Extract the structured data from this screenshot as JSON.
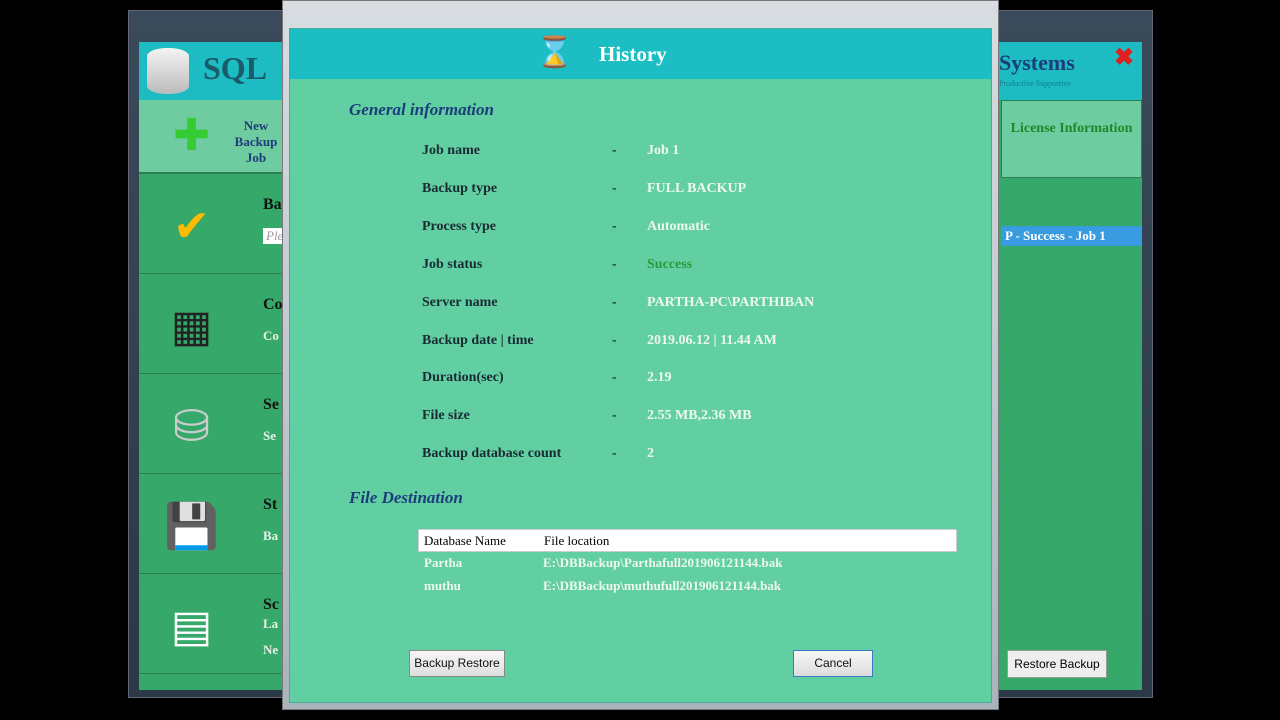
{
  "background_app": {
    "logo_text": "SQL",
    "brand": "Systems",
    "tagline": "Productive   Supportive",
    "new_backup": "New Backup Job",
    "left_items": [
      {
        "icon": "checkbox-icon",
        "title": "Ba",
        "sub": "Ple"
      },
      {
        "icon": "server-icon",
        "title": "Co",
        "sub": "Co"
      },
      {
        "icon": "database-icon",
        "title": "Se",
        "sub": "Se"
      },
      {
        "icon": "save-icon",
        "title": "St",
        "sub": "Ba"
      },
      {
        "icon": "calendar-icon",
        "title": "Sc",
        "sub": "La",
        "sub2": "Ne"
      }
    ],
    "license": "License Information",
    "selected_item": "P - Success - Job 1",
    "restore_backup": "Restore Backup"
  },
  "dialog": {
    "title": "History",
    "general_heading": "General information",
    "fields": [
      {
        "label": "Job name",
        "value": "Job 1"
      },
      {
        "label": "Backup type",
        "value": "FULL BACKUP"
      },
      {
        "label": "Process type",
        "value": "Automatic"
      },
      {
        "label": "Job status",
        "value": "Success",
        "color": "#2a9a3a"
      },
      {
        "label": "Server name",
        "value": "PARTHA-PC\\PARTHIBAN"
      },
      {
        "label": "Backup date | time",
        "value": "2019.06.12 | 11.44 AM"
      },
      {
        "label": "Duration(sec)",
        "value": "2.19"
      },
      {
        "label": "File size",
        "value": "2.55 MB,2.36 MB"
      },
      {
        "label": "Backup database count",
        "value": "2"
      }
    ],
    "separator": "-",
    "destination_heading": "File Destination",
    "table": {
      "headers": [
        "Database Name",
        "File location"
      ],
      "rows": [
        [
          "Partha",
          "E:\\DBBackup\\Parthafull201906121144.bak"
        ],
        [
          "muthu",
          "E:\\DBBackup\\muthufull201906121144.bak"
        ]
      ]
    },
    "backup_restore": "Backup Restore",
    "cancel": "Cancel"
  }
}
